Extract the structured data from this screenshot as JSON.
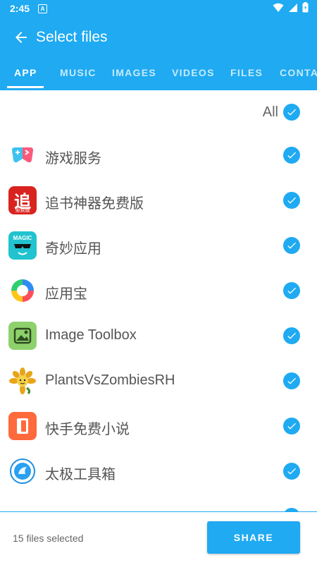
{
  "status_bar": {
    "time": "2:45",
    "notification_letter": "A"
  },
  "header": {
    "title": "Select files"
  },
  "tabs": [
    {
      "label": "APP"
    },
    {
      "label": "MUSIC"
    },
    {
      "label": "IMAGES"
    },
    {
      "label": "VIDEOS"
    },
    {
      "label": "FILES"
    },
    {
      "label": "CONTA"
    }
  ],
  "select_all": {
    "label": "All",
    "checked": true
  },
  "apps": [
    {
      "name": "游戏服务",
      "icon": "game-service-icon",
      "checked": true
    },
    {
      "name": "追书神器免费版",
      "icon": "zhuishu-icon",
      "icon_text": "追",
      "icon_subtext": "免费版",
      "checked": true
    },
    {
      "name": "奇妙应用",
      "icon": "magic-app-icon",
      "icon_text": "MAGIC",
      "checked": true
    },
    {
      "name": "应用宝",
      "icon": "yingyongbao-icon",
      "checked": true
    },
    {
      "name": "Image Toolbox",
      "icon": "image-toolbox-icon",
      "checked": true
    },
    {
      "name": "PlantsVsZombiesRH",
      "icon": "plants-vs-zombies-icon",
      "checked": true
    },
    {
      "name": "快手免费小说",
      "icon": "kuaishou-novel-icon",
      "checked": true
    },
    {
      "name": "太极工具箱",
      "icon": "taiji-toolbox-icon",
      "checked": true
    },
    {
      "name": "",
      "icon": "partial-app-icon",
      "checked": true
    }
  ],
  "footer": {
    "selected_text": "15 files selected",
    "share_label": "SHARE"
  },
  "colors": {
    "accent": "#1faaf2"
  }
}
